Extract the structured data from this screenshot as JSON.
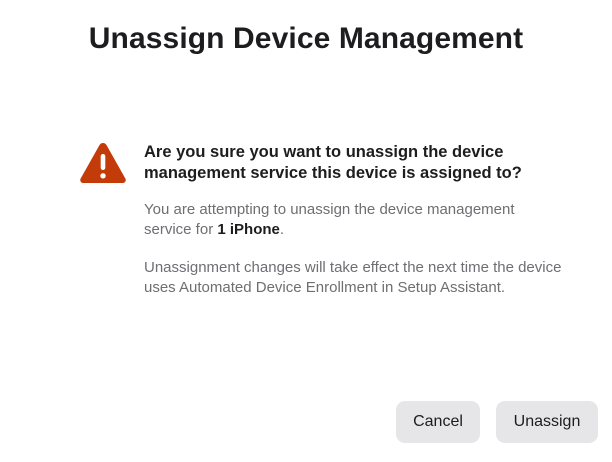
{
  "dialog": {
    "title": "Unassign Device Management",
    "warning_icon": "warning-triangle-icon",
    "warning_color": "#C23B09",
    "heading": "Are you sure you want to unassign the device management service this device is assigned to?",
    "body1_prefix": "You are attempting to unassign the device management service for ",
    "body1_count": "1 iPhone",
    "body1_suffix": ".",
    "body2": "Unassignment changes will take effect the next time the device uses Automated Device Enrollment in Setup Assistant."
  },
  "buttons": {
    "cancel_label": "Cancel",
    "unassign_label": "Unassign"
  }
}
